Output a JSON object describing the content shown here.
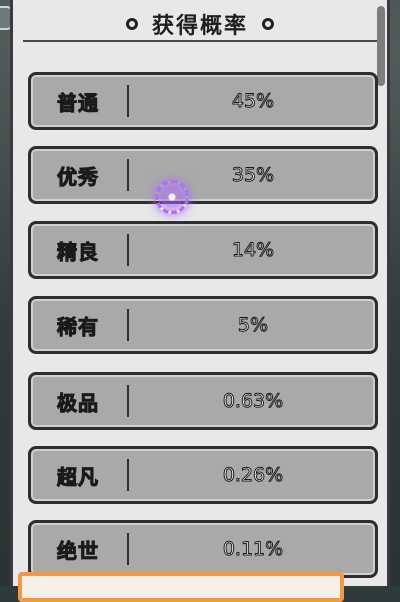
{
  "title": "获得概率",
  "rows": [
    {
      "name": "普通",
      "value": "45%",
      "name_color": "#ffffff"
    },
    {
      "name": "优秀",
      "value": "35%",
      "name_color": "#39b54a"
    },
    {
      "name": "精良",
      "value": "14%",
      "name_color": "#3c7bd6"
    },
    {
      "name": "稀有",
      "value": "5%",
      "name_color": "#a24ee6"
    },
    {
      "name": "极品",
      "value": "0.63%",
      "name_color": "#f2d34b"
    },
    {
      "name": "超凡",
      "value": "0.26%",
      "name_color": "#f0623a"
    },
    {
      "name": "绝世",
      "value": "0.11%",
      "name_color": "#e33b3b"
    }
  ],
  "colors": {
    "row_bg": "#a9a9a9",
    "panel_bg": "#e8e8e8",
    "highlight_orange": "#f09a45",
    "pointer_purple": "#b16cff"
  },
  "icons": {
    "title_ornament_left": "circle-ornament-icon",
    "title_ornament_right": "circle-ornament-icon",
    "pointer": "purple-target-icon"
  }
}
